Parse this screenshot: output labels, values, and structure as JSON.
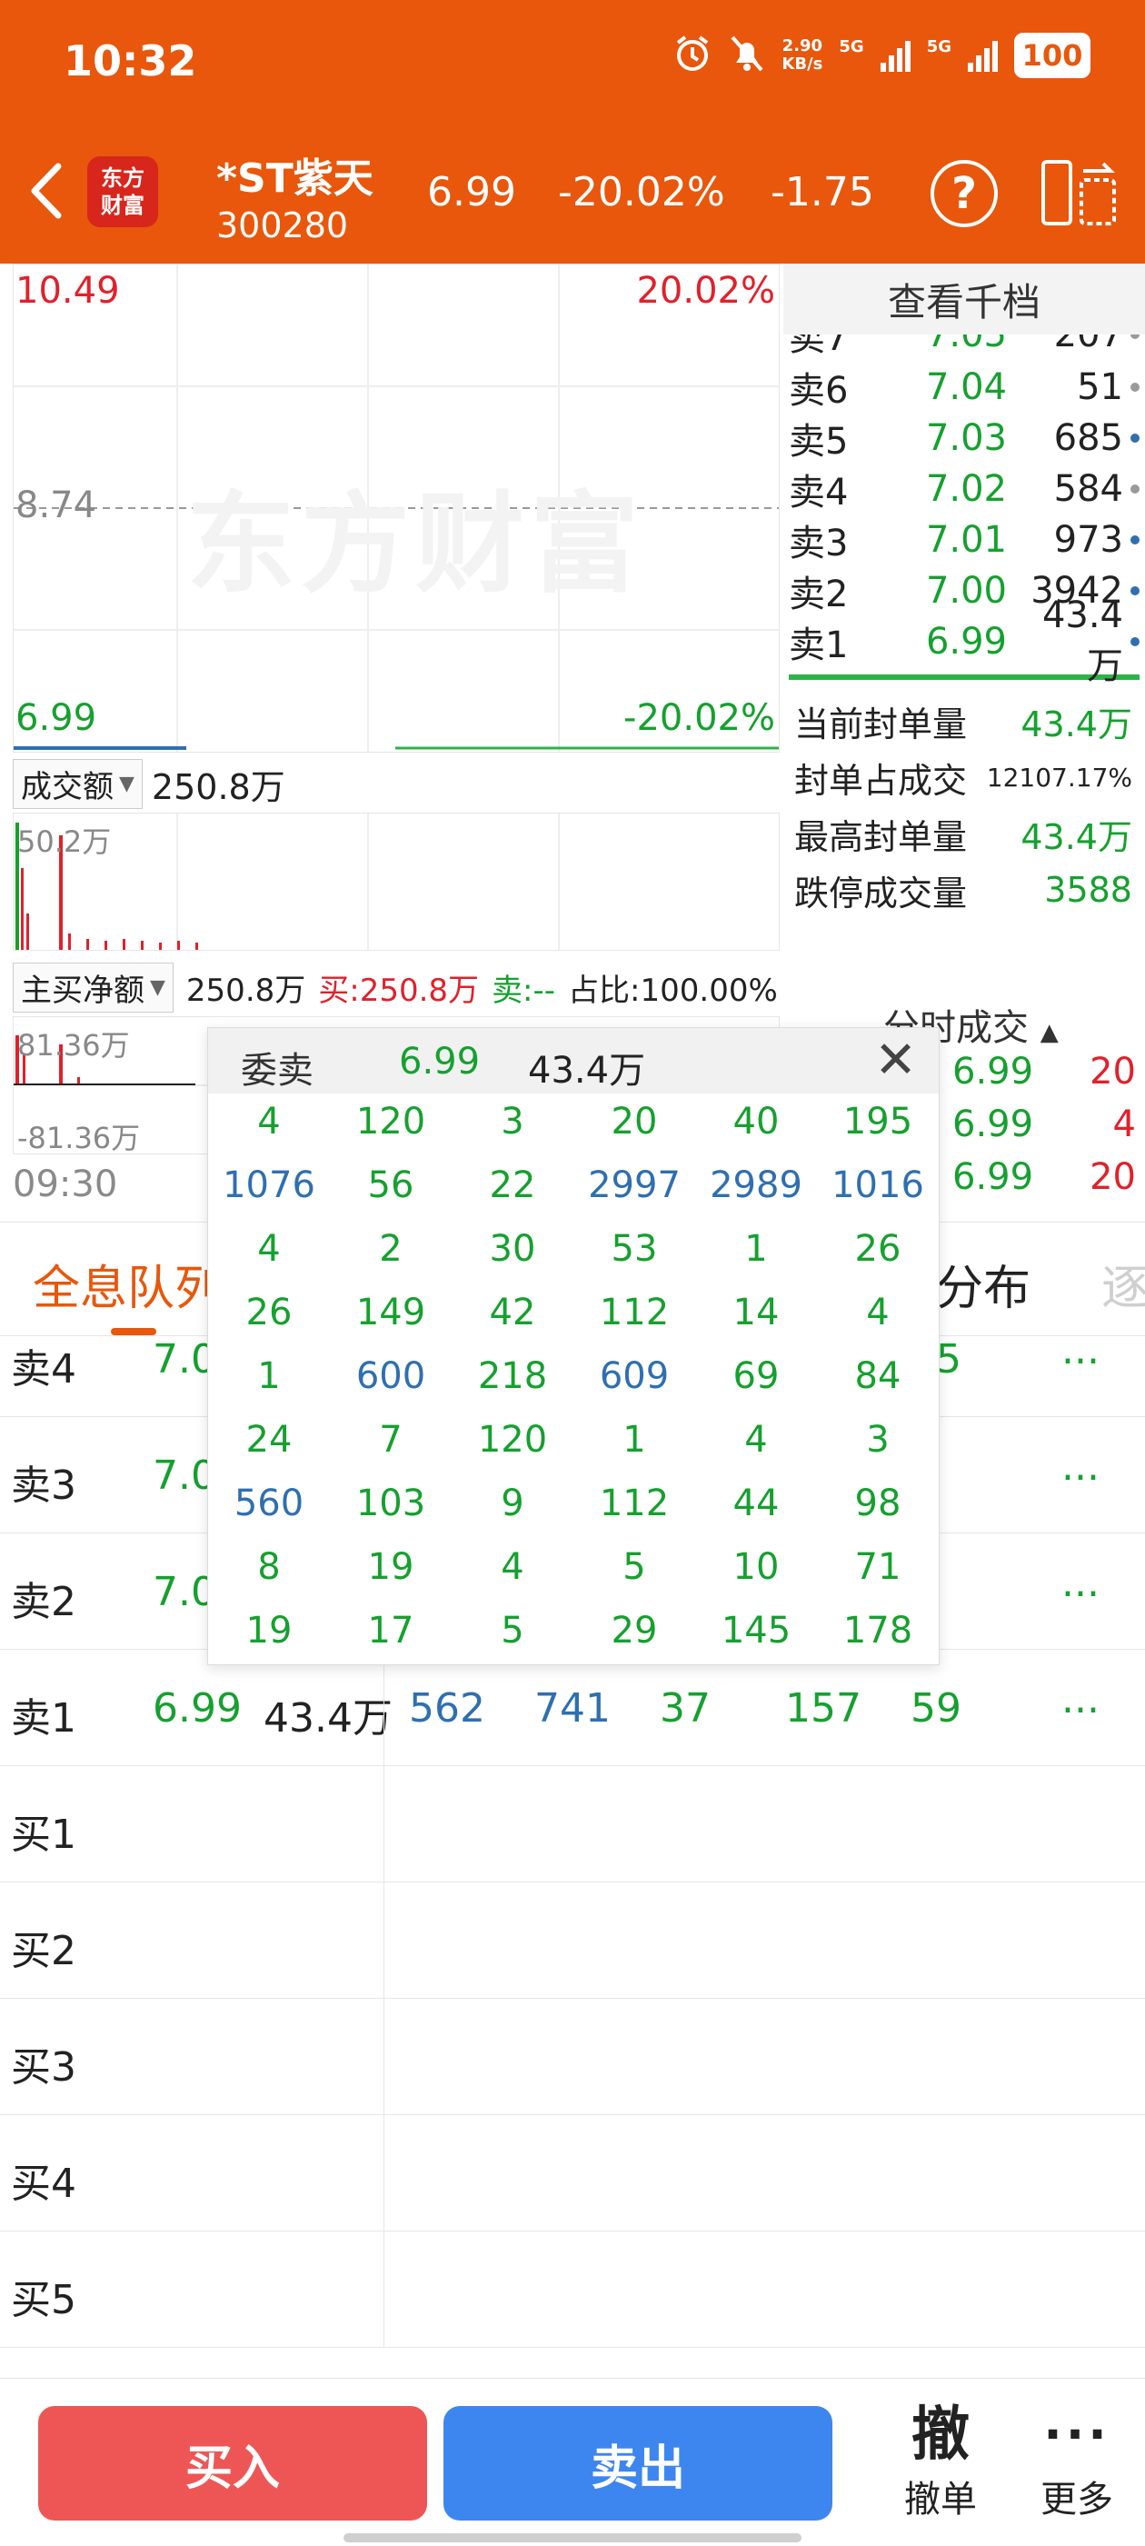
{
  "status_bar": {
    "time": "10:32",
    "speed_value": "2.90",
    "speed_unit": "KB/s",
    "net1": "5G",
    "net2": "5G",
    "battery": "100"
  },
  "header": {
    "logo_line1": "东方",
    "logo_line2": "财富",
    "stock_name": "*ST紫天",
    "stock_code": "300280",
    "price": "6.99",
    "change_pct": "-20.02%",
    "change": "-1.75",
    "help_label": "?"
  },
  "chart": {
    "high_price": "10.49",
    "high_pct": "20.02%",
    "mid_price": "8.74",
    "low_price": "6.99",
    "low_pct": "-20.02%",
    "watermark": "东方财富",
    "start_time": "09:30",
    "colors": {
      "up": "#e0212b",
      "down": "#16a02f",
      "line": "#2f6fb0"
    }
  },
  "volume": {
    "dropdown_label": "成交额",
    "value": "250.8万",
    "axis_max": "50.2万"
  },
  "flow": {
    "dropdown_label": "主买净额",
    "value": "250.8万",
    "buy_label": "买:250.8万",
    "sell_label": "卖:--",
    "ratio_label": "占比:100.00%",
    "axis_max": "81.36万",
    "axis_min": "-81.36万"
  },
  "orderbook": {
    "title": "查看千档",
    "rows": [
      {
        "label": "卖7",
        "price": "7.05",
        "qty": "207",
        "dot": "#9a9a9a"
      },
      {
        "label": "卖6",
        "price": "7.04",
        "qty": "51",
        "dot": "#9a9a9a"
      },
      {
        "label": "卖5",
        "price": "7.03",
        "qty": "685",
        "dot": "#2f6fb0"
      },
      {
        "label": "卖4",
        "price": "7.02",
        "qty": "584",
        "dot": "#9a9a9a"
      },
      {
        "label": "卖3",
        "price": "7.01",
        "qty": "973",
        "dot": "#2f6fb0"
      },
      {
        "label": "卖2",
        "price": "7.00",
        "qty": "3942",
        "dot": "#2f6fb0"
      },
      {
        "label": "卖1",
        "price": "6.99",
        "qty": "43.4万",
        "dot": "#2f6fb0"
      }
    ],
    "info": [
      {
        "label": "当前封单量",
        "value": "43.4万"
      },
      {
        "label": "封单占成交",
        "value": "12107.17%"
      },
      {
        "label": "最高封单量",
        "value": "43.4万"
      },
      {
        "label": "跌停成交量",
        "value": "3588"
      }
    ],
    "trades_title": "分时成交",
    "trades": [
      {
        "price": "6.99",
        "qty": "20"
      },
      {
        "price": "6.99",
        "qty": "4"
      },
      {
        "price": "6.99",
        "qty": "20"
      }
    ]
  },
  "tabs": {
    "active": "全息队列",
    "distribution": "分布",
    "next": "逐"
  },
  "queue": {
    "rows": [
      {
        "label": "卖4",
        "price": "7.02",
        "vol": "",
        "cells": [
          "",
          "",
          "",
          "",
          "15"
        ]
      },
      {
        "label": "卖3",
        "price": "7.01",
        "vol": "",
        "cells": [
          "",
          "",
          "",
          "",
          "3"
        ]
      },
      {
        "label": "卖2",
        "price": "7.00",
        "vol": "",
        "cells": [
          "",
          "",
          "",
          "",
          "1"
        ]
      },
      {
        "label": "卖1",
        "price": "6.99",
        "vol": "43.4万",
        "cells": [
          "562",
          "741",
          "37",
          "157",
          "59"
        ]
      },
      {
        "label": "买1",
        "price": "",
        "vol": "",
        "cells": [
          "",
          "",
          "",
          "",
          ""
        ]
      },
      {
        "label": "买2",
        "price": "",
        "vol": "",
        "cells": [
          "",
          "",
          "",
          "",
          ""
        ]
      },
      {
        "label": "买3",
        "price": "",
        "vol": "",
        "cells": [
          "",
          "",
          "",
          "",
          ""
        ]
      },
      {
        "label": "买4",
        "price": "",
        "vol": "",
        "cells": [
          "",
          "",
          "",
          "",
          ""
        ]
      },
      {
        "label": "买5",
        "price": "",
        "vol": "",
        "cells": [
          "",
          "",
          "",
          "",
          ""
        ]
      }
    ],
    "more_label": "..."
  },
  "popup": {
    "title": "委卖",
    "price": "6.99",
    "qty": "43.4万",
    "close_label": "✕",
    "rows": [
      [
        "4",
        "120",
        "3",
        "20",
        "40",
        "195"
      ],
      [
        "1076",
        "56",
        "22",
        "2997",
        "2989",
        "1016"
      ],
      [
        "4",
        "2",
        "30",
        "53",
        "1",
        "26"
      ],
      [
        "26",
        "149",
        "42",
        "112",
        "14",
        "4"
      ],
      [
        "1",
        "600",
        "218",
        "609",
        "69",
        "84"
      ],
      [
        "24",
        "7",
        "120",
        "1",
        "4",
        "3"
      ],
      [
        "560",
        "103",
        "9",
        "112",
        "44",
        "98"
      ],
      [
        "8",
        "19",
        "4",
        "5",
        "10",
        "71"
      ],
      [
        "19",
        "17",
        "5",
        "29",
        "145",
        "178"
      ]
    ],
    "blue_values": [
      "1076",
      "2997",
      "2989",
      "1016",
      "600",
      "609",
      "560"
    ]
  },
  "bottom": {
    "buy": "买入",
    "sell": "卖出",
    "cancel_big": "撤",
    "cancel_small": "撤单",
    "more_dots": "···",
    "more_small": "更多"
  }
}
